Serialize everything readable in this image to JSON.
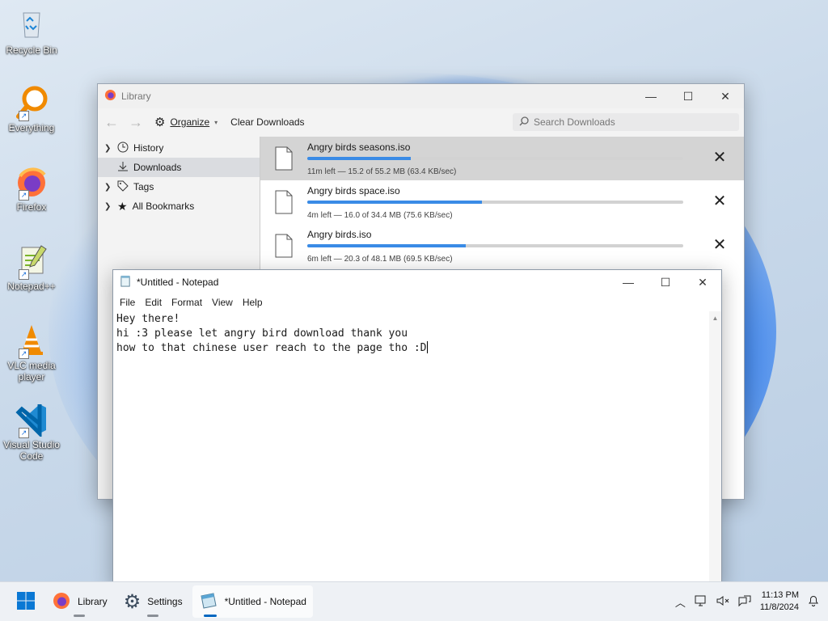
{
  "desktop": {
    "icons": [
      {
        "label": "Recycle Bin"
      },
      {
        "label": "Everything"
      },
      {
        "label": "Firefox"
      },
      {
        "label": "Notepad++"
      },
      {
        "label": "VLC media player"
      },
      {
        "label": "Visual Studio Code"
      }
    ]
  },
  "library": {
    "title": "Library",
    "toolbar": {
      "organize_label": "Organize",
      "clear_downloads_label": "Clear Downloads",
      "search_placeholder": "Search Downloads"
    },
    "sidebar": {
      "items": [
        {
          "label": "History"
        },
        {
          "label": "Downloads"
        },
        {
          "label": "Tags"
        },
        {
          "label": "All Bookmarks"
        }
      ]
    },
    "downloads": [
      {
        "name": "Angry birds seasons.iso",
        "status": "11m left — 15.2 of 55.2 MB (63.4 KB/sec)",
        "progress": 0.275
      },
      {
        "name": "Angry birds space.iso",
        "status": "4m left — 16.0 of 34.4 MB (75.6 KB/sec)",
        "progress": 0.465
      },
      {
        "name": "Angry birds.iso",
        "status": "6m left — 20.3 of 48.1 MB (69.5 KB/sec)",
        "progress": 0.422
      }
    ]
  },
  "notepad": {
    "title": "*Untitled - Notepad",
    "menu": [
      "File",
      "Edit",
      "Format",
      "View",
      "Help"
    ],
    "lines": [
      "Hey there!",
      "hi :3 please let angry bird download thank you",
      "how to that chinese user reach to the page tho :D"
    ]
  },
  "taskbar": {
    "apps": [
      {
        "label": "Library"
      },
      {
        "label": "Settings"
      },
      {
        "label": "*Untitled - Notepad"
      }
    ],
    "clock": {
      "time": "11:13 PM",
      "date": "11/8/2024"
    }
  }
}
